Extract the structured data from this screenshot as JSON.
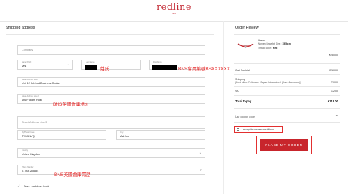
{
  "brand": {
    "logo_text": "redline",
    "logo_tagline": "PARIS"
  },
  "shipping": {
    "title": "Shipping address",
    "company": {
      "placeholder": "Company"
    },
    "name_prefix": {
      "label": "Name Prefix",
      "value": "Mrs."
    },
    "last_name": {
      "label": "Last Name"
    },
    "first_name": {
      "label": "First Name"
    },
    "street1": {
      "label": "Street Address Line",
      "value": "Unit 12 Ashford Business Centre"
    },
    "street2": {
      "label": "Street Address Line 2",
      "value": "166 Fulham Road"
    },
    "street3": {
      "placeholder": "Street Address Line 3"
    },
    "zip": {
      "label": "Zip/Postal Code",
      "value": "TW15 1YQ"
    },
    "city": {
      "label": "City",
      "value": "Ashford"
    },
    "country": {
      "label": "Country",
      "value": "United Kingdom"
    },
    "phone": {
      "label": "Phone Number",
      "value": "01784 258884"
    },
    "save_label": "Save in address book"
  },
  "annotations": {
    "last_name": "姓氏",
    "first_name": "BNS會員編號BSXXXXXX",
    "street2": "BNS英國倉庫地址",
    "phone": "BNS英國倉庫電話"
  },
  "review": {
    "title": "Order Review",
    "product": {
      "name": "Illusion",
      "size_label": "Women Bracelet Size :",
      "size_value": "15.5 cm",
      "color_label": "Thread color :",
      "color_value": "Red",
      "price": "€280.00"
    },
    "cart_subtotal": {
      "label": "Cart Subtotal",
      "value": "€280.00"
    },
    "shipping": {
      "label": "Shipping",
      "detail": "(Post office: Colissimo - Expert International (Avec Assurance))",
      "value": "€30.00"
    },
    "vat": {
      "label": "VAT",
      "value": "€32.00"
    },
    "total": {
      "label": "Total to pay",
      "value": "€318.00"
    },
    "coupon_label": "Use coupon code",
    "terms_label": "I accept terms and conditions",
    "place_order_label": "PLACE MY ORDER"
  },
  "colors": {
    "brand": "#c5303a",
    "button": "#c8252c",
    "annotation": "#e62828"
  }
}
